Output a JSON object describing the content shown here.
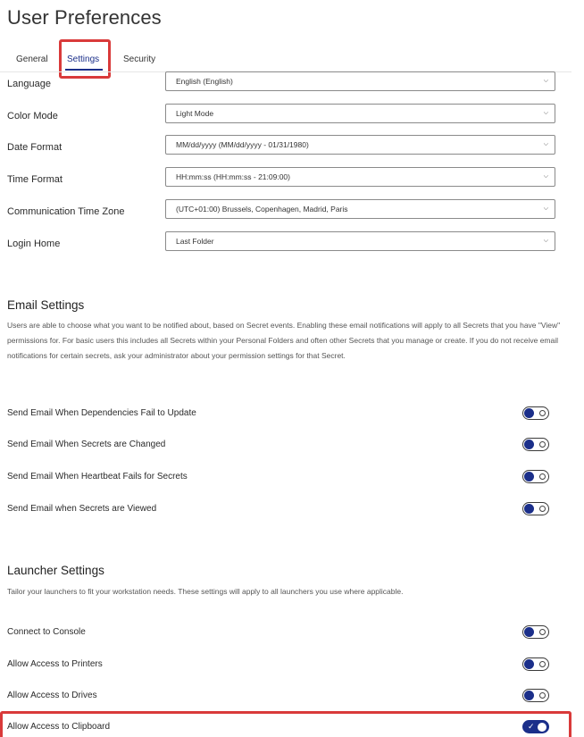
{
  "page": {
    "title": "User Preferences"
  },
  "tabs": [
    {
      "label": "General"
    },
    {
      "label": "Settings",
      "active": true
    },
    {
      "label": "Security"
    }
  ],
  "form": {
    "language": {
      "label": "Language",
      "value": "English (English)"
    },
    "color_mode": {
      "label": "Color Mode",
      "value": "Light Mode"
    },
    "date_format": {
      "label": "Date Format",
      "value": "MM/dd/yyyy (MM/dd/yyyy - 01/31/1980)"
    },
    "time_format": {
      "label": "Time Format",
      "value": "HH:mm:ss (HH:mm:ss - 21:09:00)"
    },
    "time_zone": {
      "label": "Communication Time Zone",
      "value": "(UTC+01:00) Brussels, Copenhagen, Madrid, Paris"
    },
    "login_home": {
      "label": "Login Home",
      "value": "Last Folder"
    }
  },
  "email_settings": {
    "title": "Email Settings",
    "description": "Users are able to choose what you want to be notified about, based on Secret events. Enabling these email notifications will apply to all Secrets that you have \"View\" permissions for. For basic users this includes all Secrets within your Personal Folders and often other Secrets that you manage or create. If you do not receive email notifications for certain secrets, ask your administrator about your permission settings for that Secret.",
    "items": [
      {
        "label": "Send Email When Dependencies Fail to Update",
        "enabled": false
      },
      {
        "label": "Send Email When Secrets are Changed",
        "enabled": false
      },
      {
        "label": "Send Email When Heartbeat Fails for Secrets",
        "enabled": false
      },
      {
        "label": "Send Email when Secrets are Viewed",
        "enabled": false
      }
    ]
  },
  "launcher_settings": {
    "title": "Launcher Settings",
    "description": "Tailor your launchers to fit your workstation needs. These settings will apply to all launchers you use where applicable.",
    "items": [
      {
        "label": "Connect to Console",
        "enabled": false
      },
      {
        "label": "Allow Access to Printers",
        "enabled": false
      },
      {
        "label": "Allow Access to Drives",
        "enabled": false
      },
      {
        "label": "Allow Access to Clipboard",
        "enabled": true
      }
    ]
  },
  "icons": {
    "chevron": "chevron-down-icon",
    "check": "check-icon"
  },
  "colors": {
    "accent": "#1b2f8a",
    "highlight": "#d93a3a"
  }
}
